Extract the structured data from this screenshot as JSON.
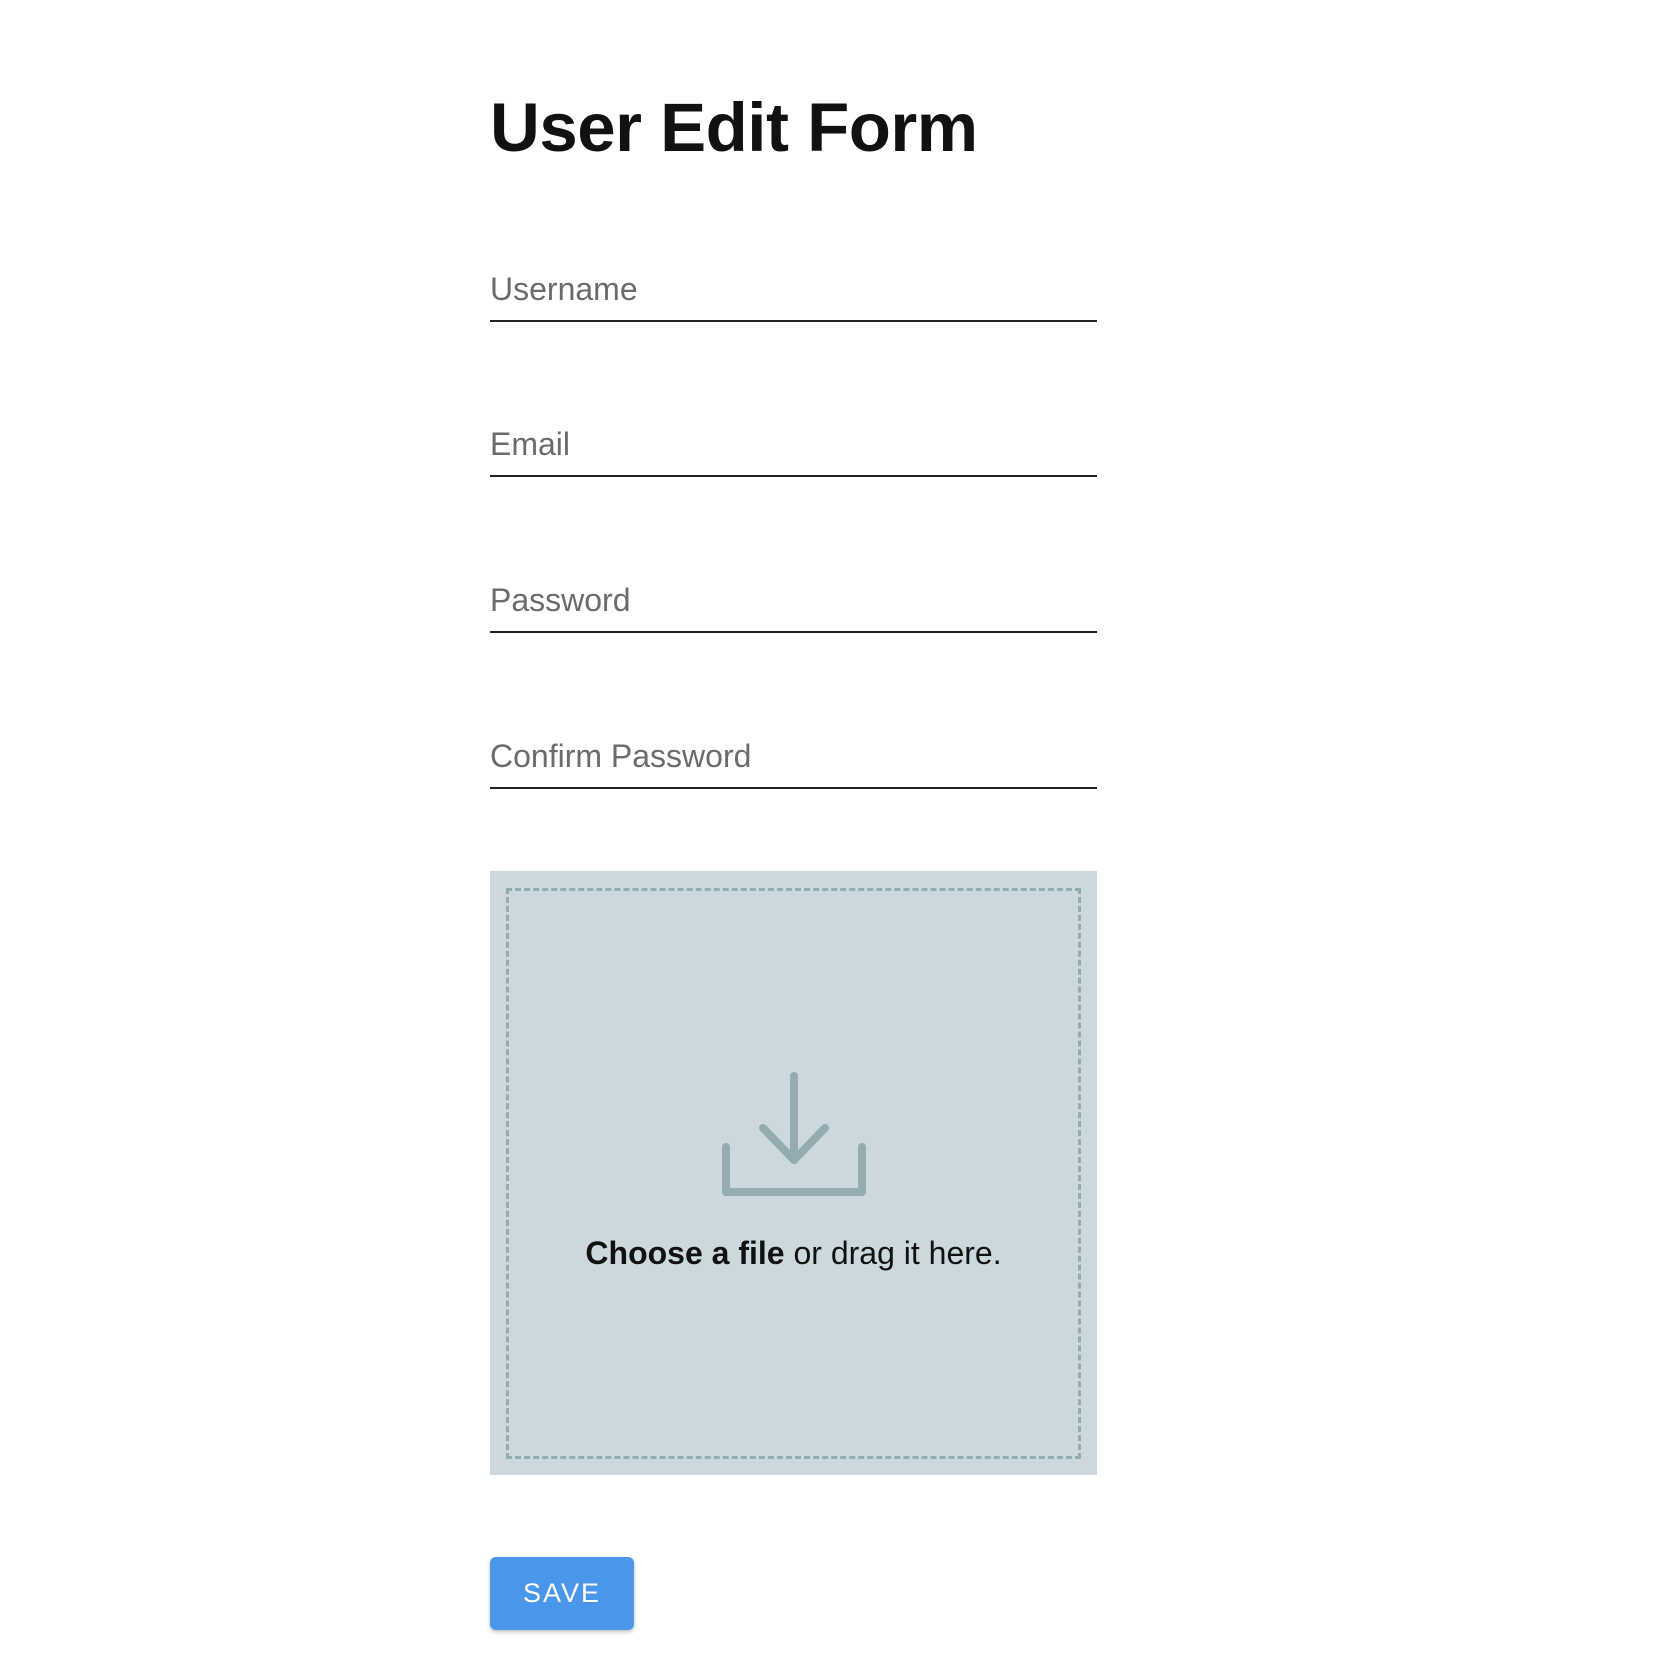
{
  "page": {
    "title": "User Edit Form"
  },
  "form": {
    "fields": [
      {
        "placeholder": "Username",
        "value": ""
      },
      {
        "placeholder": "Email",
        "value": ""
      },
      {
        "placeholder": "Password",
        "value": ""
      },
      {
        "placeholder": "Confirm Password",
        "value": ""
      }
    ],
    "dropzone": {
      "choose_label": "Choose a file",
      "drag_label": " or drag it here.",
      "icon": "download-tray-icon",
      "background_color": "#cbd8de",
      "border_color": "#94abb1"
    },
    "save_label": "SAVE",
    "save_color": "#4a96ea"
  }
}
